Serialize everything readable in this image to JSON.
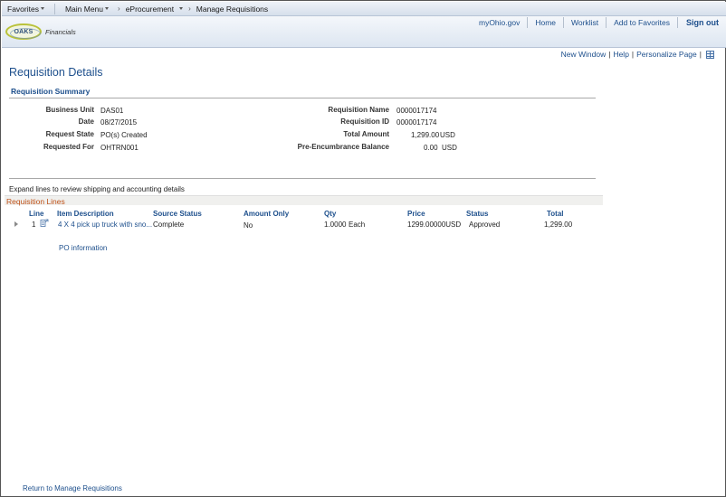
{
  "topnav": {
    "favorites": "Favorites",
    "main_menu": "Main Menu",
    "crumb_eprocurement": "eProcurement",
    "crumb_manage": "Manage Requisitions"
  },
  "header": {
    "logo_badge": "OAKS",
    "logo_text": "Financials",
    "links": {
      "myohio": "myOhio.gov",
      "home": "Home",
      "worklist": "Worklist",
      "add_favorites": "Add to Favorites",
      "sign_out": "Sign out"
    }
  },
  "utility": {
    "new_window": "New Window",
    "help": "Help",
    "personalize": "Personalize Page",
    "separator": "|"
  },
  "page": {
    "title": "Requisition Details",
    "summary_title": "Requisition Summary"
  },
  "summary": {
    "business_unit_label": "Business Unit",
    "business_unit": "DAS01",
    "date_label": "Date",
    "date": "08/27/2015",
    "request_state_label": "Request State",
    "request_state": "PO(s) Created",
    "requested_for_label": "Requested For",
    "requested_for": "OHTRN001",
    "req_name_label": "Requisition Name",
    "req_name": "0000017174",
    "req_id_label": "Requisition ID",
    "req_id": "0000017174",
    "total_amount_label": "Total Amount",
    "total_amount": "1,299.00",
    "total_currency": "USD",
    "pre_enc_label": "Pre-Encumbrance Balance",
    "pre_enc": "0.00",
    "pre_enc_currency": "USD"
  },
  "lines": {
    "expand_note": "Expand lines to review shipping and accounting details",
    "header": "Requisition Lines",
    "columns": {
      "line": "Line",
      "item_description": "Item Description",
      "source_status": "Source Status",
      "amount_only": "Amount Only",
      "qty": "Qty",
      "price": "Price",
      "status": "Status",
      "total": "Total"
    },
    "rows": [
      {
        "line": "1",
        "item_description": "4 X 4 pick up truck with sno...",
        "source_status": "Complete",
        "amount_only": "No",
        "qty": "1.0000",
        "uom": "Each",
        "price": "1299.00000USD",
        "status": "Approved",
        "total": "1,299.00"
      }
    ],
    "po_information": "PO information"
  },
  "footer": {
    "return_link": "Return to Manage Requisitions"
  }
}
